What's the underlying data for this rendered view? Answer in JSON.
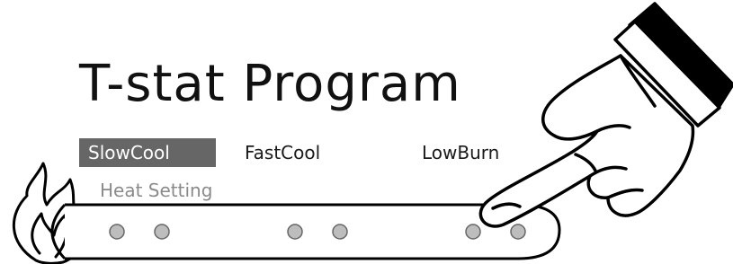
{
  "title": "T-stat Program",
  "modes": [
    {
      "label": "SlowCool",
      "selected": true
    },
    {
      "label": "FastCool",
      "selected": false
    },
    {
      "label": "LowBurn",
      "selected": false
    }
  ],
  "heat_setting_label": "Heat Setting",
  "slider": {
    "dot_count": 6,
    "dot_color": "#bdbdbd"
  },
  "icons": {
    "flame": "flame-icon",
    "pointer": "pointing-hand-icon"
  },
  "colors": {
    "selected_bg": "#666666",
    "selected_text": "#ffffff",
    "label_gray": "#8a8a8a",
    "stroke": "#000000"
  }
}
